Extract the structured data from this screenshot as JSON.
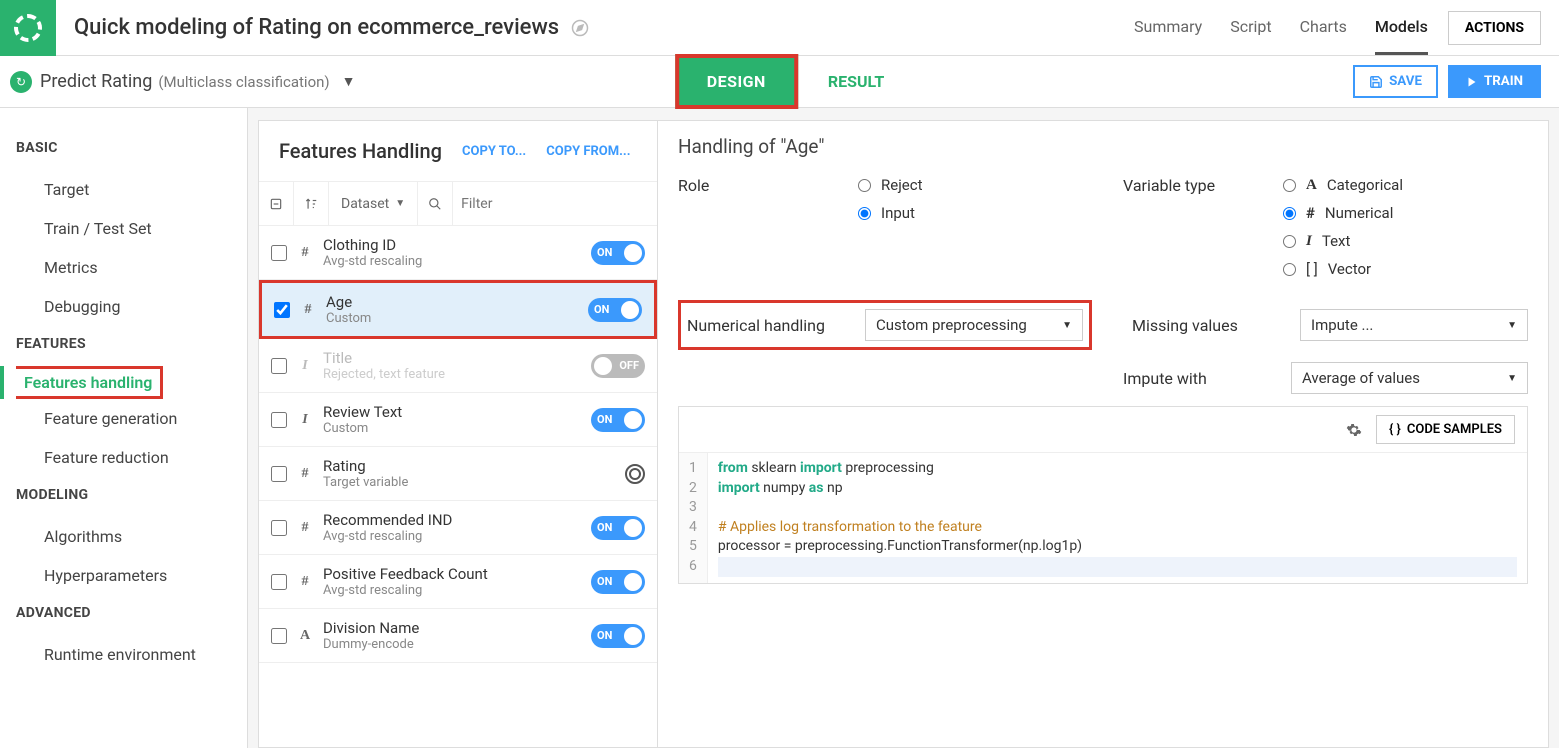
{
  "header": {
    "title": "Quick modeling of Rating on ecommerce_reviews",
    "tabs": [
      "Summary",
      "Script",
      "Charts",
      "Models"
    ],
    "active_tab": "Models",
    "actions_label": "ACTIONS"
  },
  "subheader": {
    "predict_label": "Predict Rating",
    "predict_type": "(Multiclass classification)",
    "design_label": "DESIGN",
    "result_label": "RESULT",
    "save_label": "SAVE",
    "train_label": "TRAIN"
  },
  "sidebar": {
    "sections": [
      {
        "label": "BASIC",
        "items": [
          "Target",
          "Train / Test Set",
          "Metrics",
          "Debugging"
        ]
      },
      {
        "label": "FEATURES",
        "items": [
          "Features handling",
          "Feature generation",
          "Feature reduction"
        ],
        "active": "Features handling"
      },
      {
        "label": "MODELING",
        "items": [
          "Algorithms",
          "Hyperparameters"
        ]
      },
      {
        "label": "ADVANCED",
        "items": [
          "Runtime environment"
        ]
      }
    ]
  },
  "features_panel": {
    "title": "Features Handling",
    "copy_to": "COPY TO...",
    "copy_from": "COPY FROM...",
    "dataset_label": "Dataset",
    "filter_placeholder": "Filter",
    "features": [
      {
        "type": "#",
        "name": "Clothing ID",
        "desc": "Avg-std rescaling",
        "on": true,
        "checked": false
      },
      {
        "type": "#",
        "name": "Age",
        "desc": "Custom",
        "on": true,
        "checked": true,
        "selected": true,
        "highlighted": true
      },
      {
        "type": "I",
        "name": "Title",
        "desc": "Rejected, text feature",
        "on": false,
        "checked": false,
        "disabled": true
      },
      {
        "type": "I",
        "name": "Review Text",
        "desc": "Custom",
        "on": true,
        "checked": false
      },
      {
        "type": "#",
        "name": "Rating",
        "desc": "Target variable",
        "target": true,
        "checked": false
      },
      {
        "type": "#",
        "name": "Recommended IND",
        "desc": "Avg-std rescaling",
        "on": true,
        "checked": false
      },
      {
        "type": "#",
        "name": "Positive Feedback Count",
        "desc": "Avg-std rescaling",
        "on": true,
        "checked": false
      },
      {
        "type": "A",
        "name": "Division Name",
        "desc": "Dummy-encode",
        "on": true,
        "checked": false
      }
    ],
    "toggle_on": "ON",
    "toggle_off": "OFF"
  },
  "handling_panel": {
    "title": "Handling of \"Age\"",
    "role_label": "Role",
    "role_options": [
      "Reject",
      "Input"
    ],
    "role_selected": "Input",
    "variable_type_label": "Variable type",
    "variable_type_options": [
      {
        "icon": "A",
        "label": "Categorical"
      },
      {
        "icon": "#",
        "label": "Numerical"
      },
      {
        "icon": "I",
        "label": "Text"
      },
      {
        "icon": "[ ]",
        "label": "Vector"
      }
    ],
    "variable_type_selected": "Numerical",
    "numerical_handling_label": "Numerical handling",
    "numerical_handling_value": "Custom preprocessing",
    "missing_values_label": "Missing values",
    "missing_values_value": "Impute ...",
    "impute_with_label": "Impute with",
    "impute_with_value": "Average of values",
    "code_samples_label": "CODE SAMPLES",
    "code_lines": [
      "from sklearn import preprocessing",
      "import numpy as np",
      "",
      "# Applies log transformation to the feature",
      "processor = preprocessing.FunctionTransformer(np.log1p)",
      ""
    ]
  }
}
